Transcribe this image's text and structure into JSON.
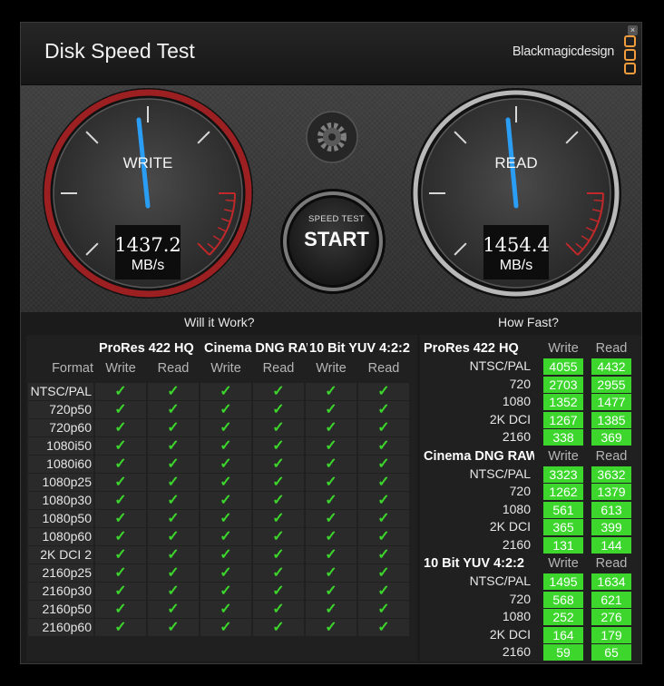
{
  "window": {
    "title": "Disk Speed Test",
    "brand": "Blackmagicdesign",
    "close_symbol": "×"
  },
  "gauges": {
    "write": {
      "label": "WRITE",
      "value": "1437.2",
      "unit": "MB/s"
    },
    "read": {
      "label": "READ",
      "value": "1454.4",
      "unit": "MB/s"
    }
  },
  "start_button": {
    "top_label": "SPEED TEST",
    "main_label": "START"
  },
  "will_it_work": {
    "heading": "Will it Work?",
    "format_header": "Format",
    "groups": [
      "ProRes 422 HQ",
      "Cinema DNG RAW",
      "10 Bit YUV 4:2:2"
    ],
    "subheaders": [
      "Write",
      "Read",
      "Write",
      "Read",
      "Write",
      "Read"
    ],
    "check_symbol": "✓",
    "rows": [
      "NTSC/PAL",
      "720p50",
      "720p60",
      "1080i50",
      "1080i60",
      "1080p25",
      "1080p30",
      "1080p50",
      "1080p60",
      "2K DCI 2",
      "2160p25",
      "2160p30",
      "2160p50",
      "2160p60"
    ],
    "checks_all_pass": true
  },
  "how_fast": {
    "heading": "How Fast?",
    "write_label": "Write",
    "read_label": "Read",
    "groups": [
      {
        "name": "ProRes 422 HQ",
        "rows": [
          {
            "format": "NTSC/PAL",
            "write": "4055",
            "read": "4432"
          },
          {
            "format": "720",
            "write": "2703",
            "read": "2955"
          },
          {
            "format": "1080",
            "write": "1352",
            "read": "1477"
          },
          {
            "format": "2K DCI",
            "write": "1267",
            "read": "1385"
          },
          {
            "format": "2160",
            "write": "338",
            "read": "369"
          }
        ]
      },
      {
        "name": "Cinema DNG RAW",
        "rows": [
          {
            "format": "NTSC/PAL",
            "write": "3323",
            "read": "3632"
          },
          {
            "format": "720",
            "write": "1262",
            "read": "1379"
          },
          {
            "format": "1080",
            "write": "561",
            "read": "613"
          },
          {
            "format": "2K DCI",
            "write": "365",
            "read": "399"
          },
          {
            "format": "2160",
            "write": "131",
            "read": "144"
          }
        ]
      },
      {
        "name": "10 Bit YUV 4:2:2",
        "rows": [
          {
            "format": "NTSC/PAL",
            "write": "1495",
            "read": "1634"
          },
          {
            "format": "720",
            "write": "568",
            "read": "621"
          },
          {
            "format": "1080",
            "write": "252",
            "read": "276"
          },
          {
            "format": "2K DCI",
            "write": "164",
            "read": "179"
          },
          {
            "format": "2160",
            "write": "59",
            "read": "65"
          }
        ]
      }
    ]
  },
  "colors": {
    "accent_red": "#c0282a",
    "needle_blue": "#2a9df4",
    "pass_green": "#3cd62c",
    "brand_orange": "#f39c3c"
  },
  "icons": [
    "close-icon",
    "gear-icon",
    "checkmark-icon",
    "blackmagic-logo-icon"
  ]
}
